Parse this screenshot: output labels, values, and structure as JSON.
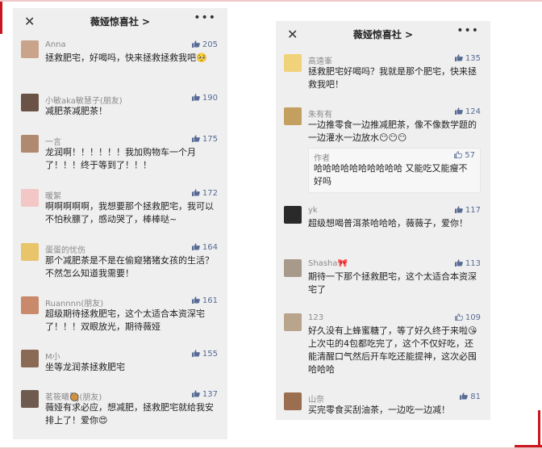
{
  "left": {
    "title": "薇娅惊喜社 >",
    "comments": [
      {
        "name": "Anna",
        "likes": "205",
        "text": "拯救肥宅，好喝吗，快来拯救拯救我吧🥺"
      },
      {
        "name": "小敏aka敏慧子(朋友)",
        "likes": "190",
        "text": "减肥茶减肥茶！"
      },
      {
        "name": "一言",
        "likes": "175",
        "text": "龙润啊！！！！！！我加购物车一个月了！！！终于等到了！！！"
      },
      {
        "name": "暖絮",
        "likes": "172",
        "text": "啊啊啊啊啊，我想要那个拯救肥宅，我可以不怕秋膘了，感动哭了，棒棒哒~"
      },
      {
        "name": "蛋蛋的忧伤",
        "likes": "164",
        "text": "那个减肥茶是不是在偷窥猪猪女孩的生活？不然怎么知道我需要！"
      },
      {
        "name": "Ruannnn(朋友)",
        "likes": "161",
        "text": "超级期待拯救肥宅，这个太适合本资深宅了！！！双眼放光，期待薇娅"
      },
      {
        "name": "M小",
        "likes": "155",
        "text": "坐等龙润茶拯救肥宅"
      },
      {
        "name": "茗筱曦🥘(朋友)",
        "likes": "137",
        "text": "薇娅有求必应，想减肥，拯救肥宅就给我安排上了！爱你😍"
      }
    ]
  },
  "right": {
    "title": "薇娅惊喜社 >",
    "comments": [
      {
        "name": "高遠峯",
        "likes": "135",
        "text": "拯救肥宅好喝吗？我就是那个肥宅，快来拯救我吧！"
      },
      {
        "name": "朱有有",
        "likes": "124",
        "text": "一边推零食一边推减肥茶，像不像数学题的一边灌水一边放水😶😶😶"
      },
      {
        "name": "yk",
        "likes": "117",
        "text": "超级想喝普洱茶哈哈哈，薇薇子，爱你！"
      },
      {
        "name": "Shasha🎀",
        "likes": "113",
        "text": "期待一下那个拯救肥宅，这个太适合本资深宅了"
      },
      {
        "name": "123",
        "likes": "109",
        "text": "好久没有上蜂蜜糖了，等了好久终于来啦😘上次屯的4包都吃完了，这个不仅好吃，还能清醒口气然后开车吃还能提神，这次必囤哈哈哈"
      },
      {
        "name": "山奈",
        "likes": "81",
        "text": "买完零食买刮油茶，一边吃一边减！"
      }
    ],
    "reply": {
      "name": "作者",
      "likes": "57",
      "text": "哈哈哈哈哈哈哈哈哈哈  又能吃又能瘦不好吗"
    }
  },
  "icons": {
    "close": "close-icon",
    "more": "more-icon",
    "thumb": "thumbs-up-icon"
  },
  "colors": {
    "accent": "#576b95",
    "frame": "#c9151e",
    "background": "#efefef"
  }
}
